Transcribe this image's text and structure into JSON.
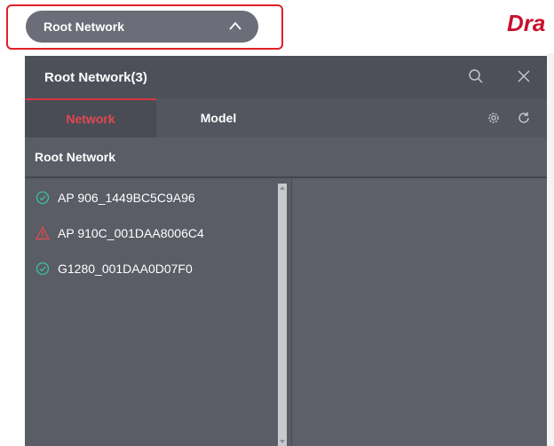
{
  "topbar": {
    "selector_label": "Root Network",
    "brand_text": "Dra"
  },
  "panel": {
    "title": "Root Network(3)",
    "tabs": [
      {
        "label": "Network",
        "active": true
      },
      {
        "label": "Model",
        "active": false
      }
    ],
    "section_label": "Root Network",
    "devices": [
      {
        "name": "AP 906_1449BC5C9A96",
        "status": "online",
        "icon": "check-circle-icon"
      },
      {
        "name": "AP 910C_001DAA8006C4",
        "status": "warning",
        "icon": "warning-triangle-icon"
      },
      {
        "name": "G1280_001DAA0D07F0",
        "status": "online",
        "icon": "check-circle-icon"
      }
    ]
  },
  "colors": {
    "highlight": "#e0202a",
    "active_tab": "#e2484f",
    "online": "#3cc39a",
    "warning": "#e8484f",
    "brand": "#c8102e"
  }
}
